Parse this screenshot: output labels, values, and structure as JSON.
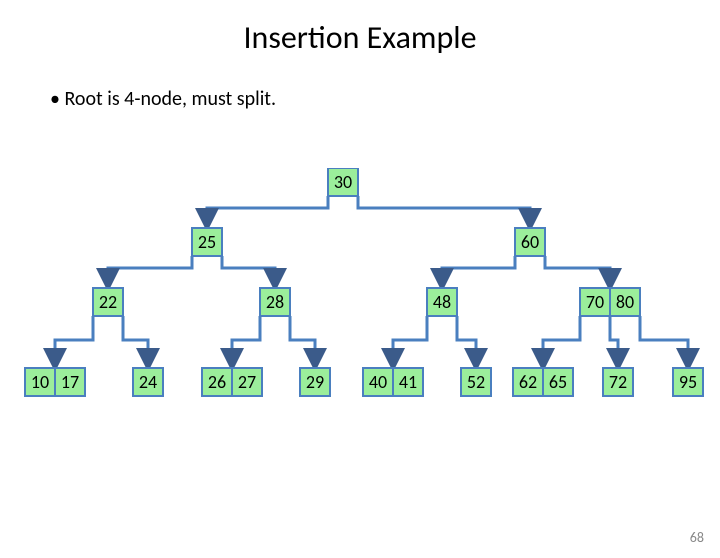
{
  "title": "Insertion Example",
  "bullet": "Root is 4-node, must split.",
  "page_number": "68",
  "tree": {
    "root": [
      "30"
    ],
    "level1_left": [
      "25"
    ],
    "level1_right": [
      "60"
    ],
    "level2_0": [
      "22"
    ],
    "level2_1": [
      "28"
    ],
    "level2_2": [
      "48"
    ],
    "level2_3": [
      "70",
      "80"
    ],
    "leaf_0": [
      "10",
      "17"
    ],
    "leaf_1": [
      "24"
    ],
    "leaf_2": [
      "26",
      "27"
    ],
    "leaf_3": [
      "29"
    ],
    "leaf_4": [
      "40",
      "41"
    ],
    "leaf_5": [
      "52"
    ],
    "leaf_6": [
      "62",
      "65"
    ],
    "leaf_7": [
      "72"
    ],
    "leaf_8": [
      "95"
    ]
  }
}
